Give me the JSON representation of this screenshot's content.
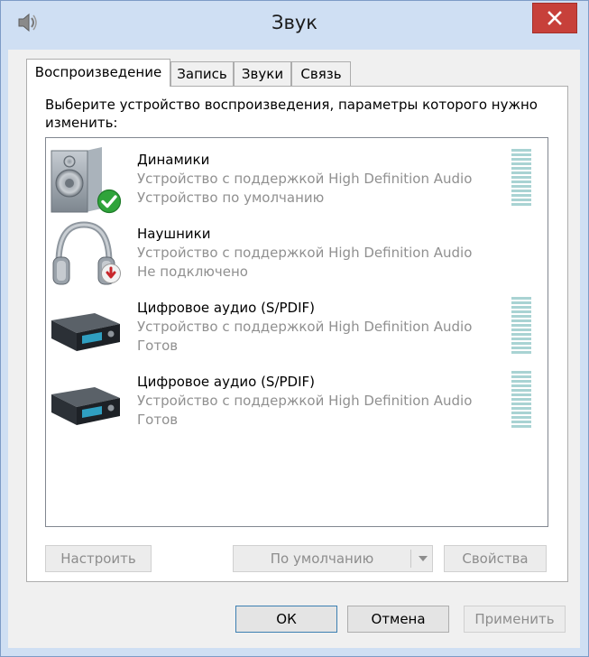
{
  "window": {
    "title": "Звук"
  },
  "tabs": [
    {
      "label": "Воспроизведение",
      "active": true
    },
    {
      "label": "Запись",
      "active": false
    },
    {
      "label": "Звуки",
      "active": false
    },
    {
      "label": "Связь",
      "active": false
    }
  ],
  "panel": {
    "instruction": "Выберите устройство воспроизведения, параметры которого нужно изменить:",
    "devices": [
      {
        "name": "Динамики",
        "description": "Устройство с поддержкой High Definition Audio",
        "status": "Устройство по умолчанию",
        "icon": "speaker-icon",
        "badge": "default-check-badge",
        "level_meter": true
      },
      {
        "name": "Наушники",
        "description": "Устройство с поддержкой High Definition Audio",
        "status": "Не подключено",
        "icon": "headphones-icon",
        "badge": "disconnected-badge",
        "level_meter": false
      },
      {
        "name": "Цифровое аудио (S/PDIF)",
        "description": "Устройство с поддержкой High Definition Audio",
        "status": "Готов",
        "icon": "digital-audio-device-icon",
        "badge": "",
        "level_meter": true
      },
      {
        "name": "Цифровое аудио (S/PDIF)",
        "description": "Устройство с поддержкой High Definition Audio",
        "status": "Готов",
        "icon": "digital-audio-device-icon",
        "badge": "",
        "level_meter": true
      }
    ],
    "buttons": {
      "configure": "Настроить",
      "set_default": "По умолчанию",
      "properties": "Свойства"
    }
  },
  "footer": {
    "ok": "ОК",
    "cancel": "Отмена",
    "apply": "Применить"
  },
  "colors": {
    "frame": "#cfdff3",
    "close_button": "#c7403a",
    "check_badge": "#2fa43a",
    "disconnected_badge": "#c8262b",
    "level_meter": "#a9d3d3",
    "disabled_text": "#8d8d8d",
    "secondary_text": "#909090"
  }
}
